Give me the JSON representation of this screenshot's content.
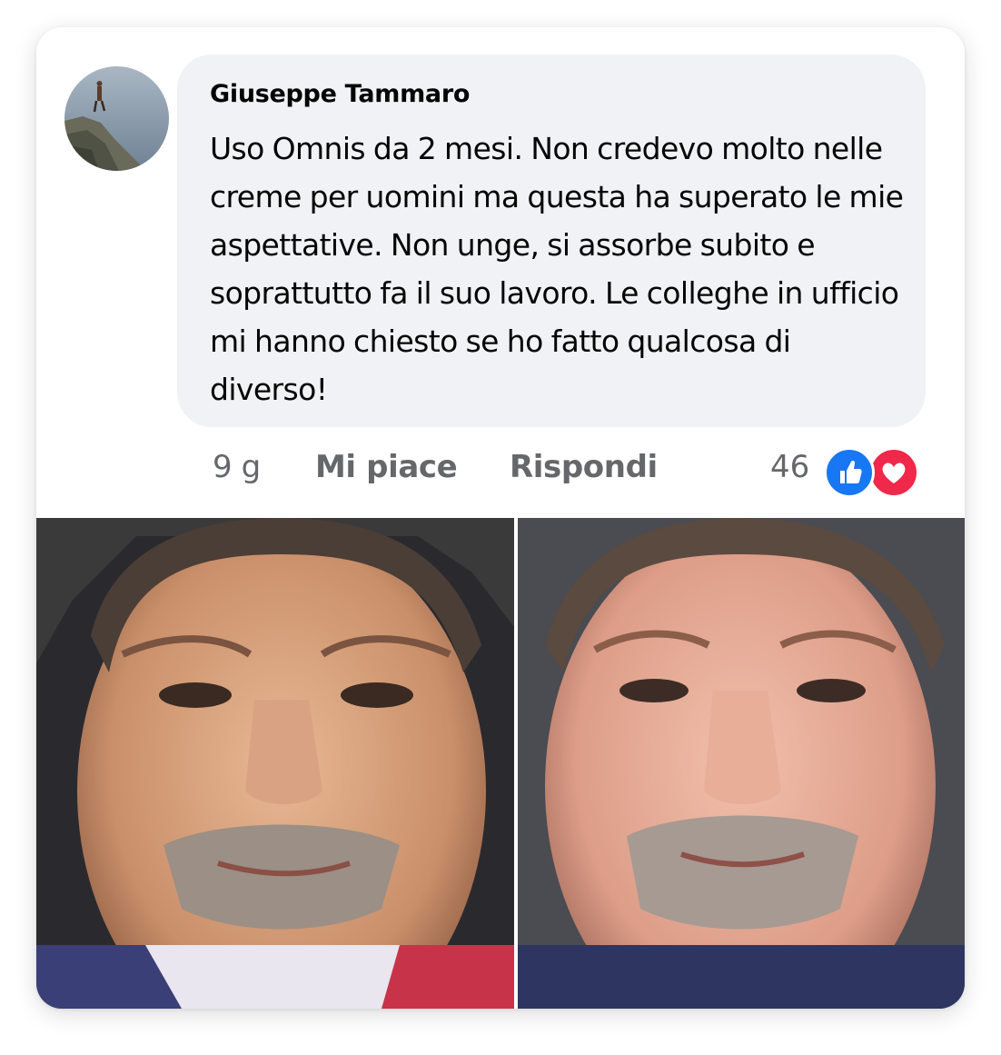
{
  "comment": {
    "author": "Giuseppe Tammaro",
    "text": "Uso Omnis da 2 mesi. Non credevo molto nelle creme per uomini ma questa ha superato le mie aspettative. Non unge, si assorbe subito e soprattutto fa il suo lavoro. Le colleghe in ufficio mi hanno chiesto se ho fatto qualcosa di diverso!",
    "avatar_icon": "profile-photo"
  },
  "actions": {
    "time": "9 g",
    "like_label": "Mi piace",
    "reply_label": "Rispondi",
    "reaction_count": "46",
    "reactions": [
      "like-icon",
      "love-icon"
    ]
  },
  "photos": [
    {
      "name": "before-photo"
    },
    {
      "name": "after-photo"
    }
  ],
  "colors": {
    "bubble": "#f0f2f5",
    "meta_text": "#65676b",
    "like_blue": "#1877f2",
    "love_red": "#f02849"
  }
}
